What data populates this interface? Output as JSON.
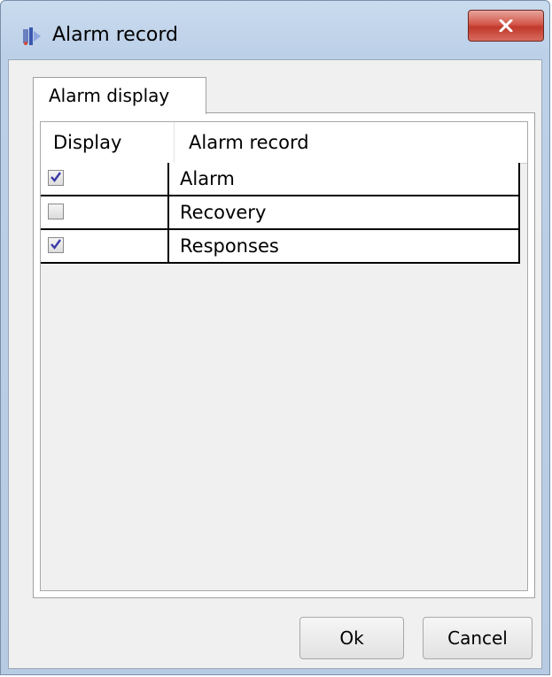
{
  "window": {
    "title": "Alarm record",
    "close_label": "x"
  },
  "tabs": [
    {
      "label": "Alarm display",
      "selected": true
    }
  ],
  "grid": {
    "columns": [
      "Display",
      "Alarm record"
    ],
    "rows": [
      {
        "checked": true,
        "label": "Alarm"
      },
      {
        "checked": false,
        "label": "Recovery"
      },
      {
        "checked": true,
        "label": "Responses"
      }
    ]
  },
  "buttons": {
    "ok_label": "Ok",
    "cancel_label": "Cancel"
  },
  "colors": {
    "titlebar": "#bcd0e8",
    "close_button": "#c0392b",
    "checkmark": "#3a3aa8"
  }
}
